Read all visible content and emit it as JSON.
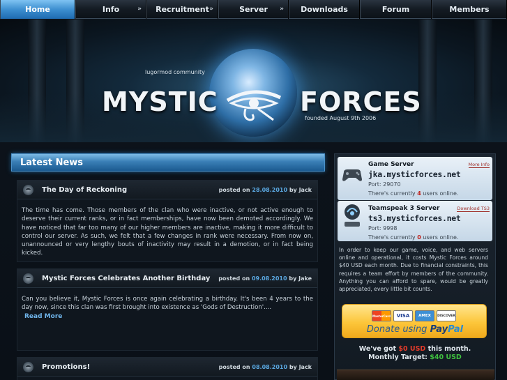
{
  "nav": {
    "items": [
      {
        "label": "Home",
        "active": true,
        "submenu": false
      },
      {
        "label": "Info",
        "active": false,
        "submenu": true
      },
      {
        "label": "Recruitment",
        "active": false,
        "submenu": true
      },
      {
        "label": "Server",
        "active": false,
        "submenu": true
      },
      {
        "label": "Downloads",
        "active": false,
        "submenu": false
      },
      {
        "label": "Forum",
        "active": false,
        "submenu": false
      },
      {
        "label": "Members",
        "active": false,
        "submenu": false
      }
    ],
    "arrow": "»"
  },
  "banner": {
    "subtitle_top": "lugormod community",
    "title_left": "MYSTIC",
    "title_right": "FORCES",
    "subtitle_bottom": "founded August 9th 2006"
  },
  "news": {
    "heading": "Latest News",
    "posted_on": "posted on",
    "by": "by",
    "posts": [
      {
        "title": "The Day of Reckoning",
        "date": "28.08.2010",
        "author": "Jack",
        "body": "The time has come. Those members of the clan who were inactive, or not active enough to deserve their current ranks, or in fact memberships, have now been demoted accordingly. We have noticed that far too many of our higher members are inactive, making it more difficult to control our server. As such, we felt that a few changes in rank were necessary. From now on, unannounced or very lengthy bouts of inactivity may result in a demotion, or in fact being kicked."
      },
      {
        "title": "Mystic Forces Celebrates Another Birthday",
        "date": "09.08.2010",
        "author": "Jake",
        "body": "Can you believe it, Mystic Forces is once again celebrating a birthday. It's been 4 years to the day now, since this clan was first brought into existence as 'Gods of Destruction'....",
        "read_more": "Read More"
      },
      {
        "title": "Promotions!",
        "date": "08.08.2010",
        "author": "Jack"
      }
    ]
  },
  "servers": {
    "game": {
      "title": "Game Server",
      "host": "jka.mysticforces.net",
      "port": "Port: 29070",
      "users_prefix": "There's currently ",
      "users_count": "4",
      "users_suffix": " users online.",
      "link": "More Info",
      "icon": "gamepad-icon"
    },
    "teamspeak": {
      "title": "Teamspeak 3 Server",
      "host": "ts3.mysticforces.net",
      "port": "Port: 9998",
      "users_prefix": "There's currently ",
      "users_count": "0",
      "users_suffix": " users online.",
      "link": "Download TS3",
      "icon": "teamspeak-icon"
    }
  },
  "donate": {
    "text": "In order to keep our game, voice, and web servers online and operational, it costs Mystic Forces around $40 USD each month. Due to financial constraints, this requires a team effort by members of the community. Anything you can afford to spare, would be greatly appreciated, every little bit counts.",
    "cards": [
      "MasterCard",
      "VISA",
      "AMEX",
      "DISCOVER"
    ],
    "button_prefix": "Donate using ",
    "button_pay": "Pay",
    "button_pal": "Pal",
    "got_prefix": "We've got ",
    "got_amount": "$0 USD",
    "got_suffix": " this month.",
    "target_prefix": "Monthly Target: ",
    "target_amount": "$40 USD"
  },
  "colors": {
    "accent": "#3d8fd0",
    "link": "#5aa7e0",
    "paypal": "#fcc63a"
  }
}
